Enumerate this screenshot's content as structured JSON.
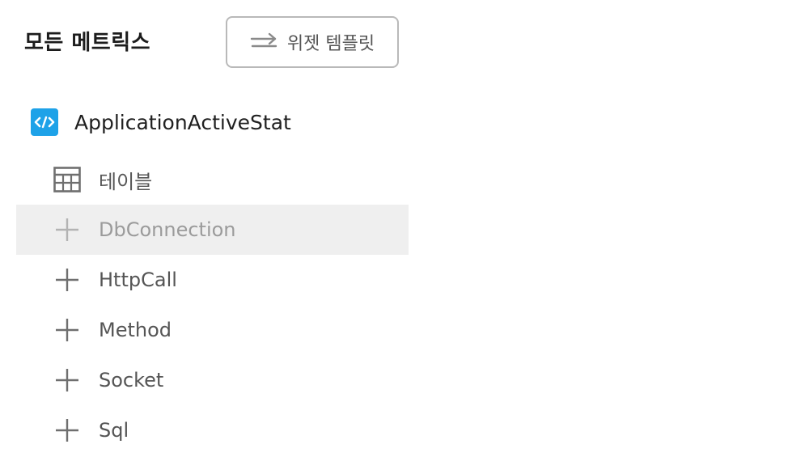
{
  "header": {
    "title": "모든 메트릭스",
    "template_button": {
      "icon": "swap-arrows-icon",
      "label": "위젯 템플릿"
    }
  },
  "tree": {
    "root": {
      "icon": "code-icon",
      "label": "ApplicationActiveStat",
      "accent_color": "#1ea2e8"
    },
    "items": [
      {
        "icon": "table-icon",
        "label": "테이블",
        "selected": false
      },
      {
        "icon": "plus-icon",
        "label": "DbConnection",
        "selected": true
      },
      {
        "icon": "plus-icon",
        "label": "HttpCall",
        "selected": false
      },
      {
        "icon": "plus-icon",
        "label": "Method",
        "selected": false
      },
      {
        "icon": "plus-icon",
        "label": "Socket",
        "selected": false
      },
      {
        "icon": "plus-icon",
        "label": "Sql",
        "selected": false
      }
    ]
  }
}
